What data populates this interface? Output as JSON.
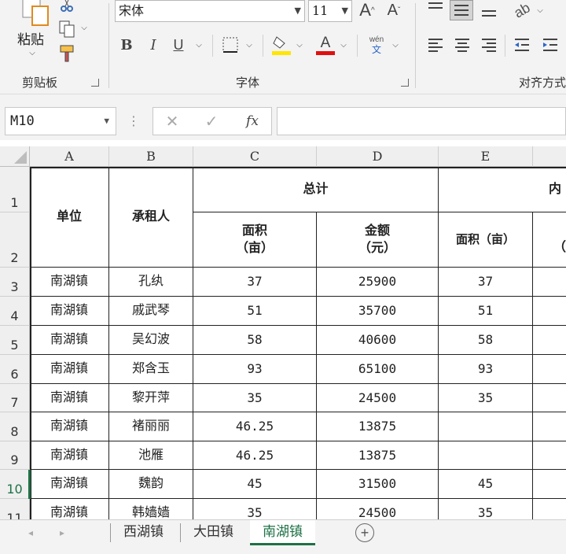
{
  "ribbon": {
    "clipboard": {
      "paste_label": "粘贴",
      "group_label": "剪贴板"
    },
    "font": {
      "font_name": "宋体",
      "font_size": "11",
      "bold": "B",
      "italic": "I",
      "underline": "U",
      "font_color_glyph": "A",
      "phonetic_top": "wén",
      "phonetic_bottom": "文",
      "group_label": "字体",
      "highlight_color": "#ffe600",
      "font_color": "#e01010"
    },
    "alignment": {
      "group_label": "对齐方式"
    }
  },
  "formula_bar": {
    "name_box": "M10",
    "fx": "fx"
  },
  "sheet": {
    "columns": [
      "A",
      "B",
      "C",
      "D",
      "E"
    ],
    "rows": [
      "1",
      "2",
      "3",
      "4",
      "5",
      "6",
      "7",
      "8",
      "9",
      "10",
      "11"
    ],
    "header": {
      "unit": "单位",
      "lessee": "承租人",
      "total": "总计",
      "area": "面积\n（亩）",
      "amount": "金额\n（元）",
      "area_e": "面积（亩）",
      "partial_f1": "内",
      "partial_f2": "（"
    },
    "data": [
      [
        "南湖镇",
        "孔纨",
        "37",
        "25900",
        "37"
      ],
      [
        "南湖镇",
        "戚武琴",
        "51",
        "35700",
        "51"
      ],
      [
        "南湖镇",
        "吴幻波",
        "58",
        "40600",
        "58"
      ],
      [
        "南湖镇",
        "郑含玉",
        "93",
        "65100",
        "93"
      ],
      [
        "南湖镇",
        "黎开萍",
        "35",
        "24500",
        "35"
      ],
      [
        "南湖镇",
        "褚丽丽",
        "46.25",
        "13875",
        ""
      ],
      [
        "南湖镇",
        "池雁",
        "46.25",
        "13875",
        ""
      ],
      [
        "南湖镇",
        "魏韵",
        "45",
        "31500",
        "45"
      ],
      [
        "南湖镇",
        "韩嫱嫱",
        "35",
        "24500",
        "35"
      ]
    ]
  },
  "tabs": {
    "items": [
      "西湖镇",
      "大田镇",
      "南湖镇"
    ],
    "active": "南湖镇"
  }
}
